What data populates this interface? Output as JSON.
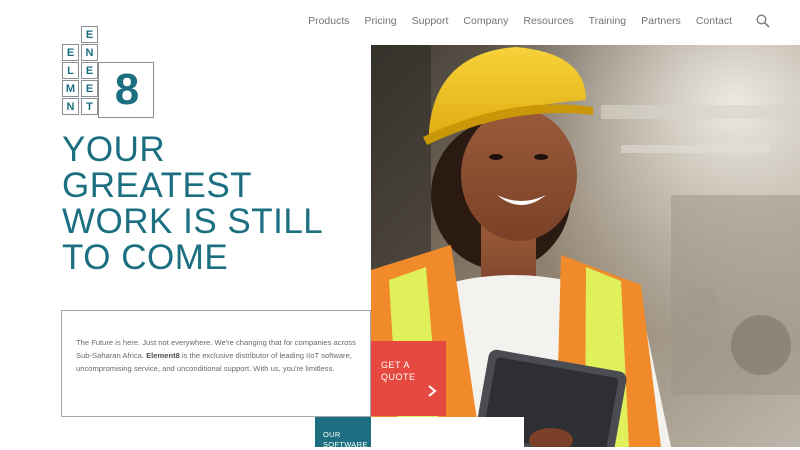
{
  "nav": {
    "items": [
      "Products",
      "Pricing",
      "Support",
      "Company",
      "Resources",
      "Training",
      "Partners",
      "Contact"
    ],
    "search_icon": "search-icon"
  },
  "logo": {
    "letters": [
      "E",
      "N",
      "E",
      "L",
      "E",
      "M",
      "E",
      "N",
      "T"
    ],
    "number": "8"
  },
  "headline": {
    "lines": [
      "YOUR",
      "GREATEST",
      "WORK IS STILL",
      "TO COME"
    ]
  },
  "intro": {
    "text_before": "The Future is here. Just not everywhere. We're changing that for companies across Sub-Saharan Africa. ",
    "brand": "Element8",
    "text_after": " is the exclusive distributor of leading IIoT software, uncompromising service, and unconditional support. With us, you're limitless."
  },
  "cta": {
    "quote_line1": "GET A",
    "quote_line2": "QUOTE",
    "software_line1": "OUR",
    "software_line2": "SOFTWARE"
  },
  "colors": {
    "brand_teal": "#1b6f80",
    "accent_red": "#e6493f",
    "hard_hat_yellow": "#f3c61c",
    "vest_orange": "#f08a2a",
    "vest_reflective": "#dff05a"
  },
  "hero_image": {
    "subject": "Smiling woman in yellow hard hat and orange safety vest holding a tablet in a factory"
  }
}
